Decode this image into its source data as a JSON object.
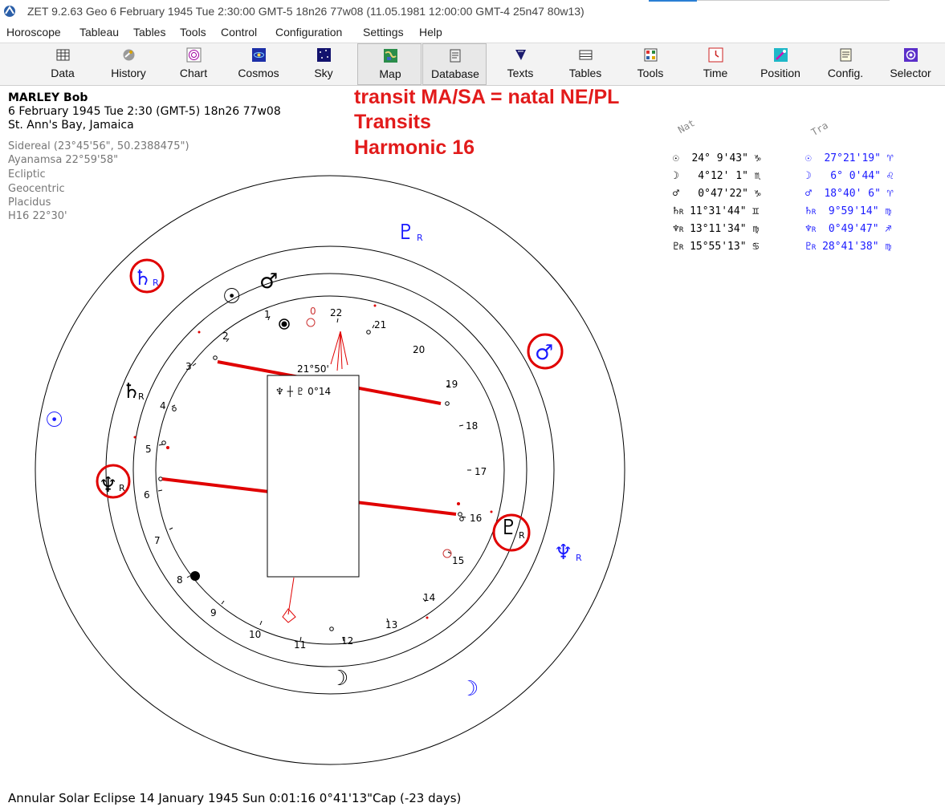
{
  "title_bar": {
    "text": "ZET 9.2.63 Geo    6 February 1945  Tue   2:30:00 GMT-5 18n26  77w08  (11.05.1981  12:00:00 GMT-4 25n47 80w13)"
  },
  "menu": [
    "Horoscope",
    "Tableau",
    "Tables",
    "Tools",
    "Control",
    "Configuration",
    "Settings",
    "Help"
  ],
  "toolbar": {
    "buttons": [
      {
        "label": "Data",
        "icon": "data-icon"
      },
      {
        "label": "History",
        "icon": "history-icon"
      },
      {
        "label": "Chart",
        "icon": "chart-icon"
      },
      {
        "label": "Cosmos",
        "icon": "cosmos-icon"
      },
      {
        "label": "Sky",
        "icon": "sky-icon"
      },
      {
        "label": "Map",
        "icon": "map-icon",
        "pressed": true
      },
      {
        "label": "Database",
        "icon": "database-icon",
        "pressed": true
      },
      {
        "label": "Texts",
        "icon": "texts-icon"
      },
      {
        "label": "Tables",
        "icon": "tables-icon"
      },
      {
        "label": "Tools",
        "icon": "tools-icon"
      },
      {
        "label": "Time",
        "icon": "time-icon"
      },
      {
        "label": "Position",
        "icon": "position-icon"
      },
      {
        "label": "Config.",
        "icon": "config-icon"
      },
      {
        "label": "Selector",
        "icon": "selector-icon"
      }
    ]
  },
  "chart_info": {
    "name": "MARLEY Bob",
    "date_line": "6 February 1945  Tue   2:30 (GMT-5) 18n26  77w08",
    "place": "St. Ann's Bay, Jamaica",
    "settings": [
      "Sidereal (23°45'56\", 50.2388475\")",
      "Ayanamsa 22°59'58\"",
      "Ecliptic",
      "Geocentric",
      "Placidus",
      "H16  22°30'"
    ]
  },
  "annotations": [
    "transit MA/SA = natal NE/PL",
    "Transits",
    "Harmonic 16"
  ],
  "planet_table": {
    "nat_header": "Nat",
    "tra_header": "Tra",
    "natal": [
      {
        "glyph": "☉",
        "r": "",
        "pos": "24° 9'43\"",
        "sign": "♑"
      },
      {
        "glyph": "☽",
        "r": "",
        "pos": " 4°12' 1\"",
        "sign": "♏"
      },
      {
        "glyph": "♂",
        "r": "",
        "pos": " 0°47'22\"",
        "sign": "♑"
      },
      {
        "glyph": "♄",
        "r": "R",
        "pos": "11°31'44\"",
        "sign": "♊"
      },
      {
        "glyph": "♆",
        "r": "R",
        "pos": "13°11'34\"",
        "sign": "♍"
      },
      {
        "glyph": "♇",
        "r": "R",
        "pos": "15°55'13\"",
        "sign": "♋"
      }
    ],
    "transit": [
      {
        "glyph": "☉",
        "r": "",
        "pos": "27°21'19\"",
        "sign": "♈"
      },
      {
        "glyph": "☽",
        "r": "",
        "pos": " 6° 0'44\"",
        "sign": "♌"
      },
      {
        "glyph": "♂",
        "r": "",
        "pos": "18°40' 6\"",
        "sign": "♈"
      },
      {
        "glyph": "♄",
        "r": "R",
        "pos": " 9°59'14\"",
        "sign": "♍"
      },
      {
        "glyph": "♆",
        "r": "R",
        "pos": " 0°49'47\"",
        "sign": "♐"
      },
      {
        "glyph": "♇",
        "r": "R",
        "pos": "28°41'38\"",
        "sign": "♍"
      }
    ]
  },
  "wheel": {
    "dial_numbers": [
      "0",
      "1",
      "2",
      "3",
      "4",
      "5",
      "6",
      "7",
      "8",
      "9",
      "10",
      "11",
      "12",
      "13",
      "14",
      "15",
      "16",
      "17",
      "18",
      "19",
      "20",
      "21",
      "22"
    ],
    "midpoint_label": "21°50'",
    "midpoint_box_text": "♆ ┼ ♇   0°14",
    "natal_planets": [
      {
        "glyph": "☉",
        "r": ""
      },
      {
        "glyph": "♂",
        "r": ""
      },
      {
        "glyph": "♄",
        "r": "R"
      },
      {
        "glyph": "♆",
        "r": "R"
      },
      {
        "glyph": "♇",
        "r": "R"
      },
      {
        "glyph": "☽",
        "r": ""
      }
    ],
    "transit_planets": [
      {
        "glyph": "♇",
        "r": "R"
      },
      {
        "glyph": "♄",
        "r": "R"
      },
      {
        "glyph": "♂",
        "r": ""
      },
      {
        "glyph": "☉",
        "r": ""
      },
      {
        "glyph": "♆",
        "r": "R"
      },
      {
        "glyph": "☽",
        "r": ""
      }
    ],
    "natal_color": "#000000",
    "transit_color": "#1a1aff",
    "highlight_color": "#e00000"
  },
  "status": {
    "text": "Annular Solar Eclipse 14 January 1945 Sun  0:01:16  0°41'13\"Cap (-23 days)"
  }
}
